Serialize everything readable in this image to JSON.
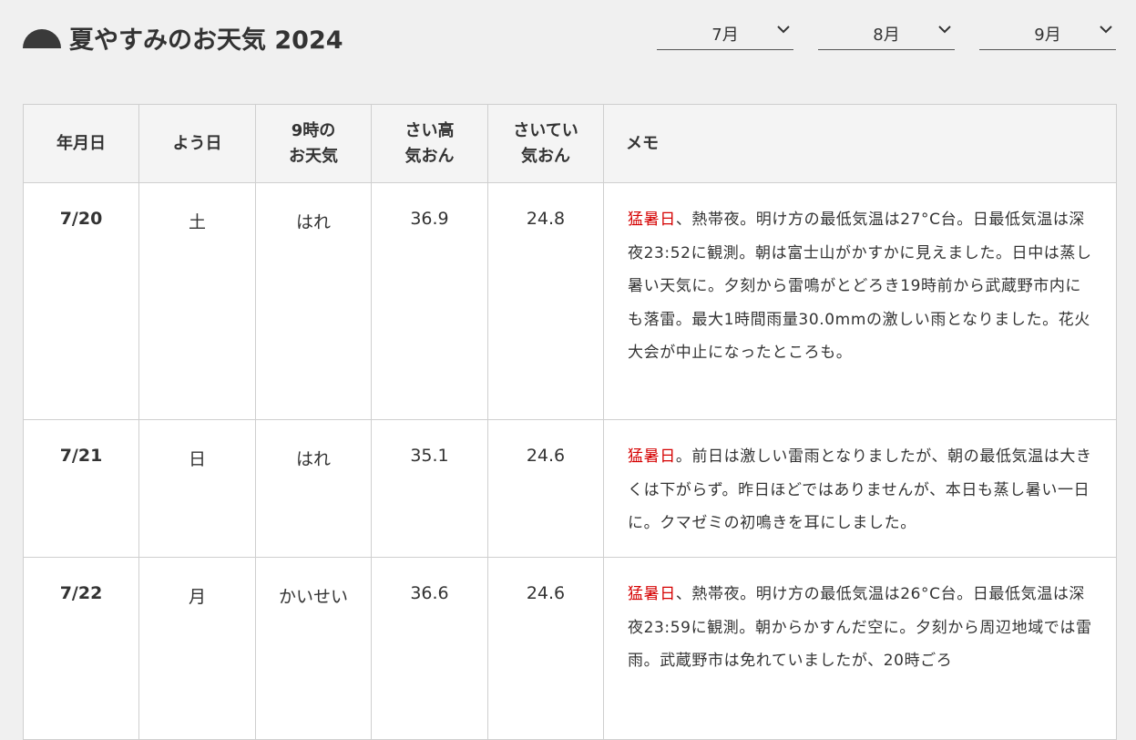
{
  "header": {
    "title": "夏やすみのお天気 2024",
    "icon": "sun-icon"
  },
  "month_selects": [
    {
      "label": "7月",
      "icon": "chevron-down-icon"
    },
    {
      "label": "8月",
      "icon": "chevron-down-icon"
    },
    {
      "label": "9月",
      "icon": "chevron-down-icon"
    }
  ],
  "table": {
    "headers": {
      "date": "年月日",
      "dow": "よう日",
      "weather_line1": "9時の",
      "weather_line2": "お天気",
      "high_line1": "さい高",
      "high_line2": "気おん",
      "low_line1": "さいてい",
      "low_line2": "気おん",
      "memo": "メモ"
    },
    "rows": [
      {
        "date": "7/20",
        "dow": "土",
        "weather": "はれ",
        "high": "36.9",
        "low": "24.8",
        "memo_highlight": "猛暑日",
        "memo_text": "、熱帯夜。明け方の最低気温は27°C台。日最低気温は深夜23:52に観測。朝は富士山がかすかに見えました。日中は蒸し暑い天気に。夕刻から雷鳴がとどろき19時前から武蔵野市内にも落雷。最大1時間雨量30.0mmの激しい雨となりました。花火大会が中止になったところも。"
      },
      {
        "date": "7/21",
        "dow": "日",
        "weather": "はれ",
        "high": "35.1",
        "low": "24.6",
        "memo_highlight": "猛暑日",
        "memo_text": "。前日は激しい雷雨となりましたが、朝の最低気温は大きくは下がらず。昨日ほどではありませんが、本日も蒸し暑い一日に。クマゼミの初鳴きを耳にしました。"
      },
      {
        "date": "7/22",
        "dow": "月",
        "weather": "かいせい",
        "high": "36.6",
        "low": "24.6",
        "memo_highlight": "猛暑日",
        "memo_text": "、熱帯夜。明け方の最低気温は26°C台。日最低気温は深夜23:59に観測。朝からかすんだ空に。夕刻から周辺地域では雷雨。武蔵野市は免れていましたが、20時ごろ"
      }
    ]
  }
}
